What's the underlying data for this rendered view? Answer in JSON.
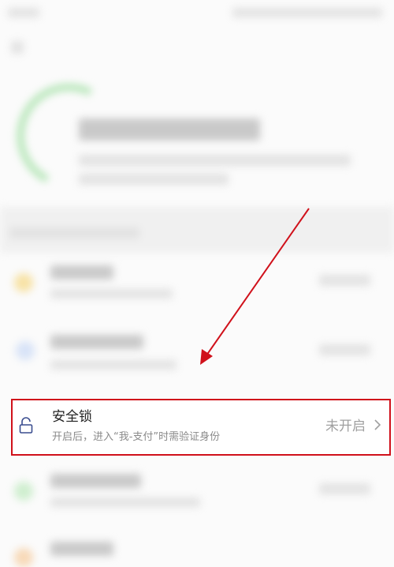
{
  "security_lock_row": {
    "title": "安全锁",
    "subtitle": "开启后，进入“我-支付”时需验证身份",
    "status": "未开启",
    "highlight_color": "#d0111b"
  },
  "icons": {
    "lock": "lock-icon",
    "chevron": "chevron-right-icon"
  },
  "annotation": {
    "arrow_color": "#d0111b"
  }
}
